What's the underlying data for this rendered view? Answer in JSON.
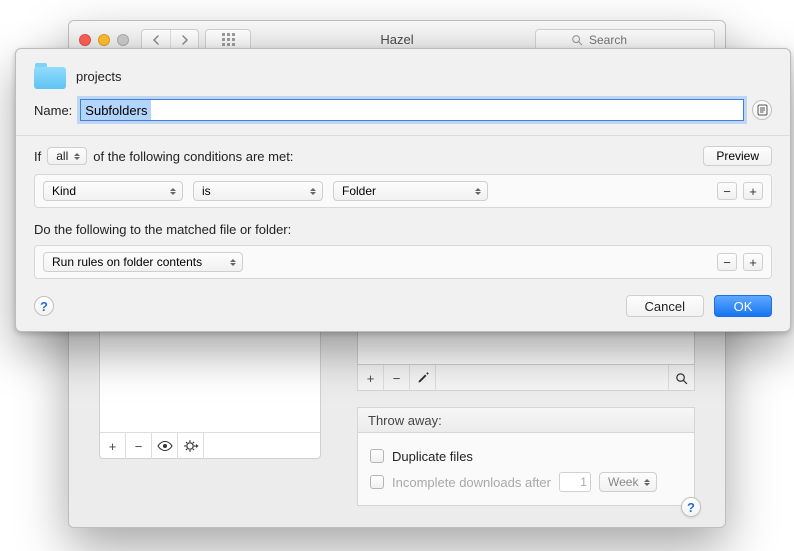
{
  "window": {
    "title": "Hazel",
    "search_placeholder": "Search"
  },
  "sheet": {
    "folder_name": "projects",
    "name_label": "Name:",
    "name_value": "Subfolders",
    "conditions_prefix": "If",
    "conditions_scope": "all",
    "conditions_suffix": "of the following conditions are met:",
    "preview_label": "Preview",
    "rule": {
      "attribute": "Kind",
      "operator": "is",
      "value": "Folder"
    },
    "actions_label": "Do the following to the matched file or folder:",
    "action": "Run rules on folder contents",
    "cancel_label": "Cancel",
    "ok_label": "OK"
  },
  "throw_away": {
    "header": "Throw away:",
    "duplicate_label": "Duplicate files",
    "incomplete_label": "Incomplete downloads after",
    "incomplete_value": "1",
    "incomplete_unit": "Week"
  },
  "glyphs": {
    "plus": "+",
    "minus": "−",
    "pencil": "✎",
    "search": "",
    "eye": "",
    "gear": "",
    "help": "?",
    "doc": ""
  }
}
